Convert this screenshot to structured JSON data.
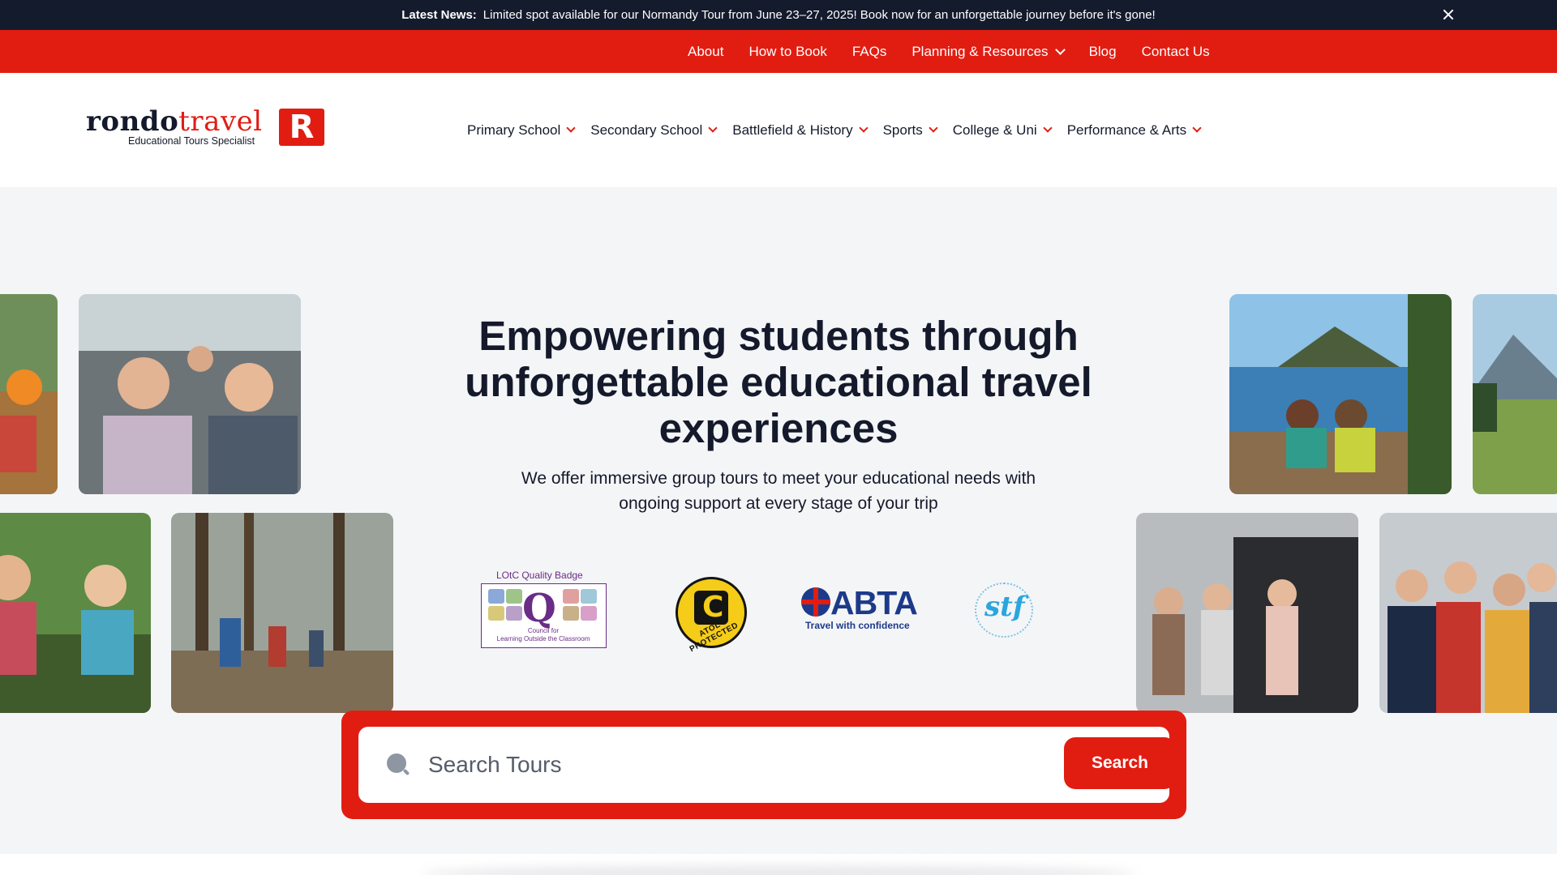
{
  "news": {
    "label": "Latest News:",
    "text": "Limited spot available for our Normandy Tour from June 23–27, 2025! Book now for an unforgettable journey before it's gone!"
  },
  "topnav": {
    "items": [
      {
        "label": "About"
      },
      {
        "label": "How to Book"
      },
      {
        "label": "FAQs"
      },
      {
        "label": "Planning & Resources",
        "dropdown": true
      },
      {
        "label": "Blog"
      },
      {
        "label": "Contact Us"
      }
    ]
  },
  "logo": {
    "word_part1": "rondo",
    "word_part2": "travel",
    "tagline": "Educational Tours Specialist",
    "mark": "R"
  },
  "mainnav": {
    "items": [
      {
        "label": "Primary School"
      },
      {
        "label": "Secondary School"
      },
      {
        "label": "Battlefield & History"
      },
      {
        "label": "Sports"
      },
      {
        "label": "College & Uni"
      },
      {
        "label": "Performance & Arts"
      }
    ]
  },
  "hero": {
    "headline_line1": "Empowering students through",
    "headline_line2": "unforgettable educational travel",
    "headline_line3": "experiences",
    "subline_line1": "We offer immersive group tours to meet your educational needs with",
    "subline_line2": "ongoing support at every stage of your trip"
  },
  "badges": {
    "lotc_title": "LOtC Quality Badge",
    "lotc_caption_1": "Council for",
    "lotc_caption_2": "Learning Outside the Classroom",
    "atol_text": "ATOL PROTECTED",
    "abta_word": "ABTA",
    "abta_tag": "Travel with confidence",
    "stf_word": "stf"
  },
  "search": {
    "placeholder": "Search Tours",
    "value": "",
    "button_label": "Search"
  },
  "colors": {
    "brand_red": "#e11d12",
    "navy": "#141b2d",
    "hero_bg": "#f4f5f7"
  }
}
